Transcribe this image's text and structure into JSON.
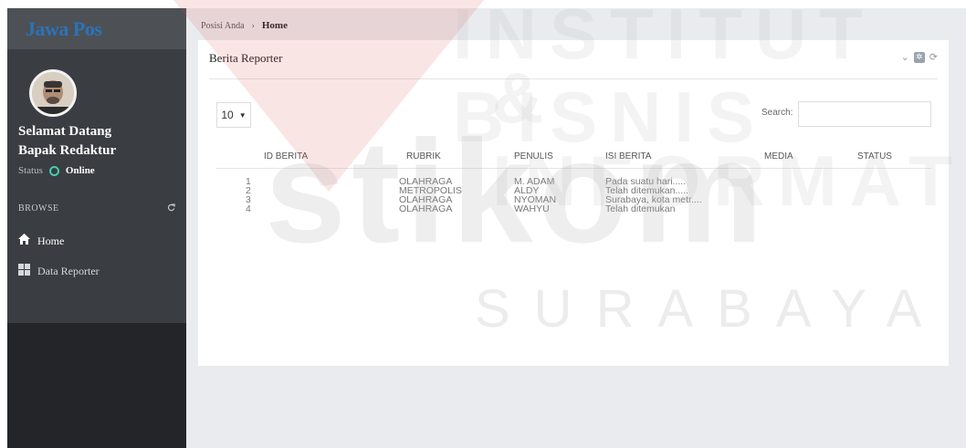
{
  "sidebar": {
    "brand": "Jawa Pos",
    "greeting_line1": "Selamat Datang",
    "greeting_line2": "Bapak Redaktur",
    "status_label": "Status",
    "status_value": "Online",
    "browse_label": "BROWSE",
    "nav": [
      {
        "label": "Home",
        "icon": "home-icon"
      },
      {
        "label": "Data Reporter",
        "icon": "grid-icon"
      }
    ]
  },
  "breadcrumb": {
    "prefix": "Posisi Anda",
    "separator": "›",
    "current": "Home"
  },
  "panel": {
    "title": "Berita Reporter",
    "page_length": "10",
    "search_label": "Search:",
    "search_value": ""
  },
  "table": {
    "headers": [
      "ID BERITA",
      "RUBRIK",
      "PENULIS",
      "ISI BERITA",
      "MEDIA",
      "STATUS"
    ],
    "rows": [
      [
        "1",
        "OLAHRAGA",
        "M. ADAM",
        "Pada suatu hari.....",
        "",
        ""
      ],
      [
        "2",
        "METROPOLIS",
        "ALDY",
        "Telah ditemukan.....",
        "",
        ""
      ],
      [
        "3",
        "OLAHRAGA",
        "NYOMAN",
        "Surabaya, kota metr....",
        "",
        ""
      ],
      [
        "4",
        "OLAHRAGA",
        "WAHYU",
        "Telah ditemukan",
        "",
        ""
      ]
    ]
  },
  "watermark": {
    "line1": "INSTITUT BISNIS",
    "line2": "& INFORMATIKA",
    "line3": "stikom",
    "line4": "SURABAYA"
  },
  "colors": {
    "brand": "#2c73b8",
    "sidebar_bg": "#3a3d42",
    "online_dot": "#3fd0b0"
  }
}
